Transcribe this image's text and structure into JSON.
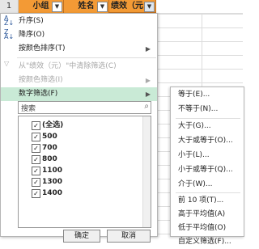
{
  "sheet": {
    "row_number": "1",
    "col1": "小组",
    "col2": "姓名",
    "col3": "绩效（元",
    "filter_btn": "▼"
  },
  "menu": {
    "items": [
      {
        "label": "升序(S)",
        "icon": "sort-asc-icon"
      },
      {
        "label": "降序(O)",
        "icon": "sort-desc-icon"
      },
      {
        "label": "按颜色排序(T)",
        "arrow": "▶"
      },
      {
        "label": "从\"绩效（元）\"中清除筛选(C)",
        "disabled": true,
        "icon": "clear-filter-icon"
      },
      {
        "label": "按颜色筛选(I)",
        "disabled": true,
        "arrow": "▶"
      },
      {
        "label": "数字筛选(F)",
        "arrow": "▶",
        "highlighted": true
      }
    ],
    "search_placeholder": "搜索",
    "list": [
      {
        "label": "(全选)",
        "checked": true
      },
      {
        "label": "500",
        "checked": true
      },
      {
        "label": "700",
        "checked": true
      },
      {
        "label": "800",
        "checked": true
      },
      {
        "label": "1100",
        "checked": true
      },
      {
        "label": "1300",
        "checked": true
      },
      {
        "label": "1400",
        "checked": true
      }
    ],
    "ok_label": "确定",
    "cancel_label": "取消"
  },
  "submenu": {
    "items": [
      "等于(E)...",
      "不等于(N)...",
      "大于(G)...",
      "大于或等于(O)...",
      "小于(L)...",
      "小于或等于(Q)...",
      "介于(W)...",
      "前 10 项(T)...",
      "高于平均值(A)",
      "低于平均值(O)",
      "自定义筛选(F)..."
    ]
  },
  "colors": {
    "header": "#f39a35",
    "highlight": "#c9ead6"
  }
}
